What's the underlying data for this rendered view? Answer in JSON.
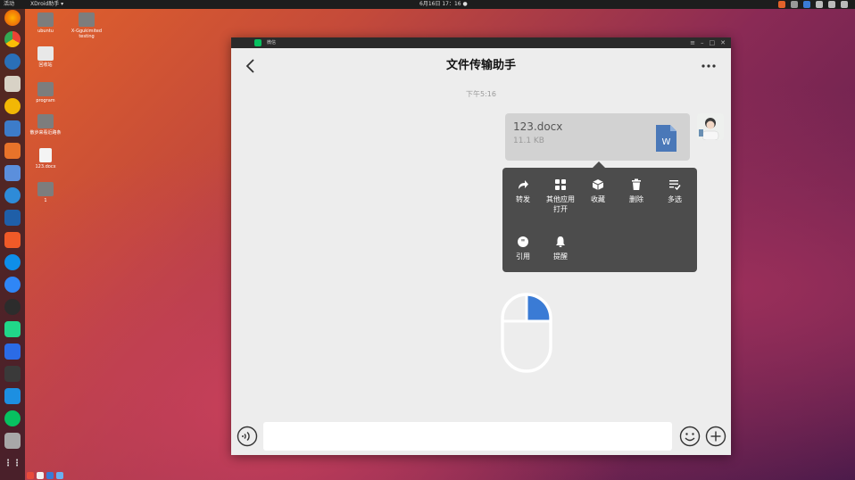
{
  "system": {
    "activities": "活动",
    "app_menu": "XDroid助手 ▾",
    "clock": "6月16日 17：16 ●"
  },
  "desktop": {
    "icons": [
      {
        "label": "ubuntu"
      },
      {
        "label": "X-Ggukimited testing"
      },
      {
        "label": "回收站"
      },
      {
        "label": "program"
      },
      {
        "label": "散步来看近路条"
      },
      {
        "label": "123.docx"
      },
      {
        "label": "1"
      }
    ]
  },
  "window": {
    "app_title": "微信",
    "controls": [
      "≡",
      "–",
      "□",
      "✕"
    ],
    "chat_title": "文件传输助手",
    "timestamp": "下午5:16",
    "file": {
      "name": "123.docx",
      "size": "11.1 KB",
      "type_badge": "W"
    },
    "context_menu": [
      {
        "label": "转发",
        "icon": "forward-icon"
      },
      {
        "label": "其他应用\n打开",
        "icon": "apps-icon"
      },
      {
        "label": "收藏",
        "icon": "favorite-icon"
      },
      {
        "label": "删除",
        "icon": "delete-icon"
      },
      {
        "label": "多选",
        "icon": "multiselect-icon"
      },
      {
        "label": "引用",
        "icon": "quote-icon"
      },
      {
        "label": "提醒",
        "icon": "bell-icon"
      }
    ],
    "input": {
      "value": "",
      "placeholder": ""
    }
  },
  "colors": {
    "wechat_green": "#07c160",
    "word_blue": "#2b579a",
    "menu_bg": "#4c4c4c",
    "mouse_accent": "#3a7bd5"
  }
}
